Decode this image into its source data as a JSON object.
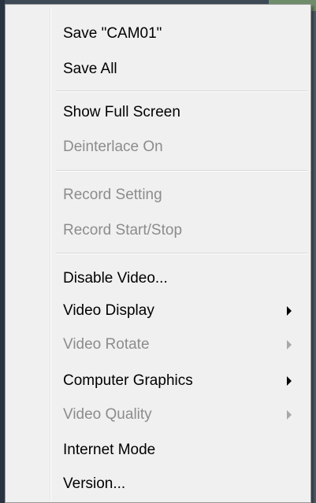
{
  "menu": {
    "items": [
      {
        "label": "Save \"CAM01\"",
        "enabled": true,
        "submenu": false
      },
      {
        "label": "Save All",
        "enabled": true,
        "submenu": false
      },
      {
        "label": "Show Full Screen",
        "enabled": true,
        "submenu": false
      },
      {
        "label": "Deinterlace On",
        "enabled": false,
        "submenu": false
      },
      {
        "label": "Record Setting",
        "enabled": false,
        "submenu": false
      },
      {
        "label": "Record Start/Stop",
        "enabled": false,
        "submenu": false
      },
      {
        "label": "Disable Video...",
        "enabled": true,
        "submenu": false
      },
      {
        "label": "Video Display",
        "enabled": true,
        "submenu": true
      },
      {
        "label": "Video Rotate",
        "enabled": false,
        "submenu": true
      },
      {
        "label": "Computer Graphics",
        "enabled": true,
        "submenu": true
      },
      {
        "label": "Video Quality",
        "enabled": false,
        "submenu": true
      },
      {
        "label": "Internet Mode",
        "enabled": true,
        "submenu": false
      },
      {
        "label": "Version...",
        "enabled": true,
        "submenu": false
      }
    ]
  },
  "colors": {
    "menu_background": "#f0f0f0",
    "text_enabled": "#000000",
    "text_disabled": "#8c8c8c"
  }
}
